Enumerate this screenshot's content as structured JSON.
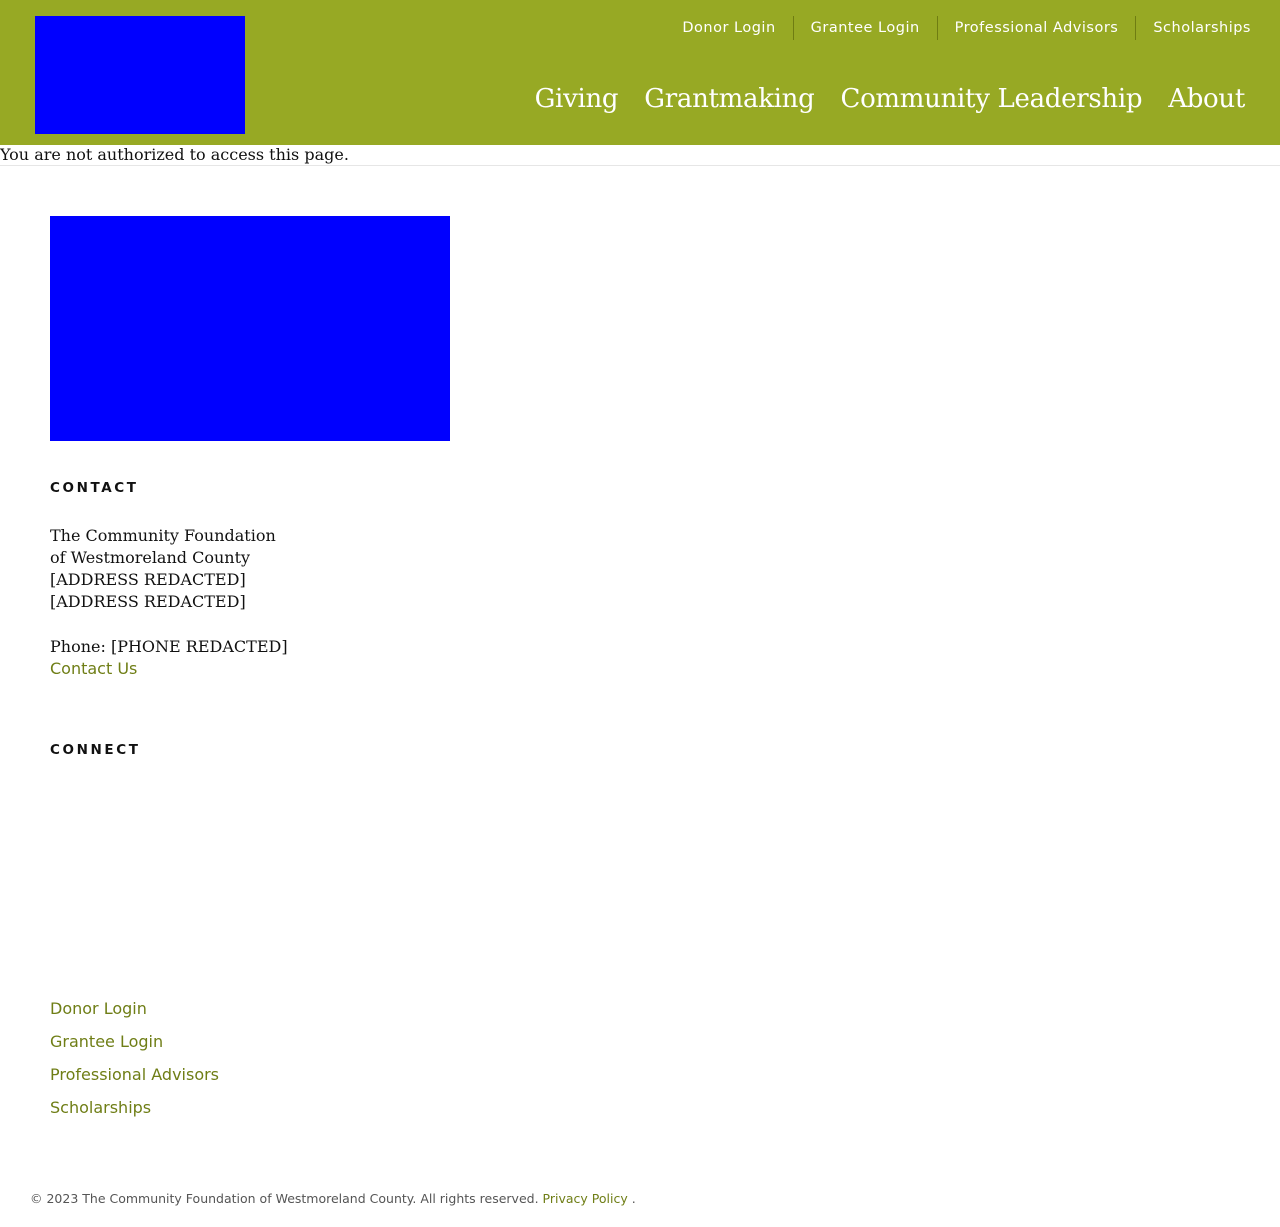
{
  "header": {
    "utility_nav": [
      "Donor Login",
      "Grantee Login",
      "Professional Advisors",
      "Scholarships"
    ],
    "main_nav": [
      "Giving",
      "Grantmaking",
      "Community Leadership",
      "About"
    ]
  },
  "notice": "You are not authorized to access this page.",
  "footer": {
    "contact_heading": "CONTACT",
    "org_name_line1": "The Community Foundation",
    "org_name_line2": "of Westmoreland County",
    "address_line1": "[ADDRESS REDACTED]",
    "address_line2": "[ADDRESS REDACTED]",
    "phone": "Phone: [PHONE REDACTED]",
    "contact_link": "Contact Us",
    "connect_heading": "CONNECT",
    "links": [
      "Donor Login",
      "Grantee Login",
      "Professional Advisors",
      "Scholarships"
    ],
    "copyright": "© 2023 The Community Foundation of Westmoreland County. All rights reserved.",
    "privacy_link": "Privacy Policy",
    "trailing_period": "."
  },
  "colors": {
    "header_bg": "#97a924",
    "link": "#6f7e16",
    "logo_placeholder": "#0000ff"
  }
}
